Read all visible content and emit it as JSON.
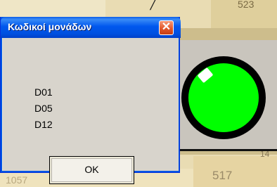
{
  "dialog": {
    "title": "Κωδικοί μονάδων",
    "codes": [
      "D01",
      "D05",
      "D12"
    ],
    "ok_label": "OK"
  },
  "background": {
    "top_text": "/",
    "top_number": "523",
    "bottom_number": "517",
    "left_number": "1057",
    "right_number": "14"
  },
  "indicator": {
    "color": "#00ff00",
    "state": "on"
  }
}
